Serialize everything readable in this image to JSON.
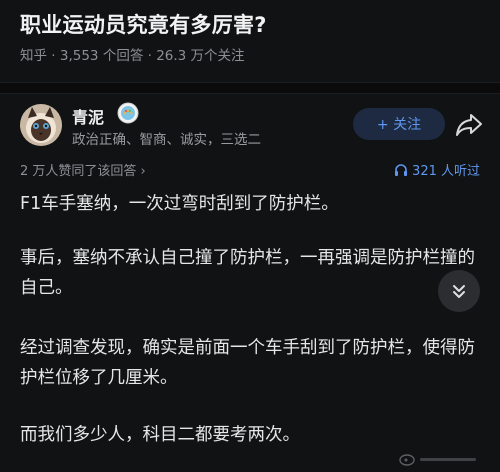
{
  "question": {
    "title": "职业运动员究竟有多厉害?",
    "source": "知乎",
    "answers_count": "3,553 个回答",
    "followers_count": "26.3 万个关注",
    "separator": " · "
  },
  "author": {
    "name": "青泥",
    "bio": "政治正确、智商、诚实，三选二",
    "follow_label": "+ 关注"
  },
  "answer_meta": {
    "upvotes": "2 万人赞同了该回答",
    "upvotes_chevron": "›",
    "listeners": "321 人听过"
  },
  "content": {
    "p1": "F1车手塞纳，一次过弯时刮到了防护栏。",
    "p2": "事后，塞纳不承认自己撞了防护栏，一再强调是防护栏撞的自己。",
    "p3": "经过调查发现，确实是前面一个车手刮到了防护栏，使得防护栏位移了几厘米。",
    "p4": "而我们多少人，科目二都要考两次。"
  },
  "icons": {
    "badge": "badge-icon",
    "share": "share-icon",
    "headphones": "headphones-icon",
    "collapse": "chevron-double-down-icon"
  },
  "colors": {
    "background": "#111214",
    "accent": "#5f97ee",
    "follow_bg": "#1d2a42",
    "muted_text": "#8e8f94"
  }
}
